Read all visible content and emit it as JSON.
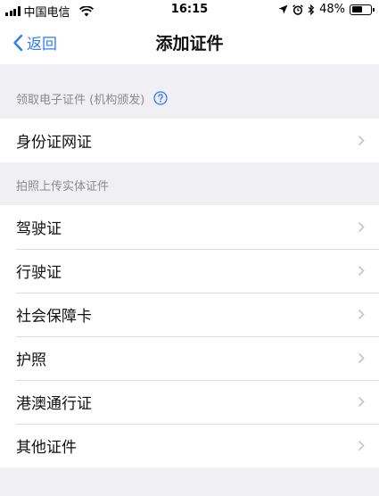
{
  "status_bar": {
    "carrier": "中国电信",
    "time": "16:15",
    "battery_percent": "48%",
    "battery_level": 0.48,
    "icons": [
      "signal-icon",
      "wifi-icon",
      "location-icon",
      "alarm-icon",
      "bluetooth-icon",
      "battery-icon"
    ]
  },
  "nav": {
    "back_label": "返回",
    "title": "添加证件"
  },
  "sections": {
    "electronic": {
      "header": "领取电子证件 (机构颁发)",
      "items": [
        {
          "label": "身份证网证"
        }
      ]
    },
    "photo": {
      "header": "拍照上传实体证件",
      "items": [
        {
          "label": "驾驶证"
        },
        {
          "label": "行驶证"
        },
        {
          "label": "社会保障卡"
        },
        {
          "label": "护照"
        },
        {
          "label": "港澳通行证"
        },
        {
          "label": "其他证件"
        }
      ]
    }
  },
  "colors": {
    "accent": "#2f7cf6",
    "background": "#efeff4",
    "section_text": "#8a8a8f",
    "chevron": "#c7c7cc"
  }
}
